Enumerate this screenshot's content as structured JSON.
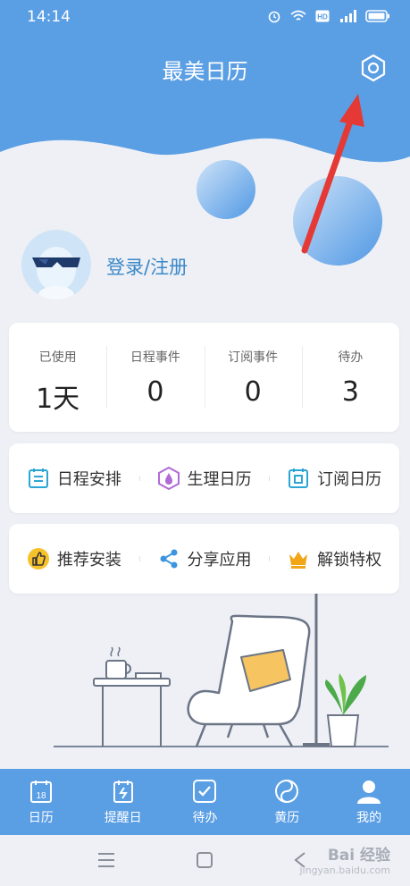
{
  "status_bar": {
    "time": "14:14"
  },
  "header": {
    "title": "最美日历"
  },
  "profile": {
    "login_label": "登录/注册"
  },
  "stats": [
    {
      "label": "已使用",
      "value": "1天"
    },
    {
      "label": "日程事件",
      "value": "0"
    },
    {
      "label": "订阅事件",
      "value": "0"
    },
    {
      "label": "待办",
      "value": "3"
    }
  ],
  "features_row1": [
    {
      "label": "日程安排",
      "icon": "schedule-icon"
    },
    {
      "label": "生理日历",
      "icon": "drop-icon"
    },
    {
      "label": "订阅日历",
      "icon": "subscribe-icon"
    }
  ],
  "features_row2": [
    {
      "label": "推荐安装",
      "icon": "thumbs-up-icon"
    },
    {
      "label": "分享应用",
      "icon": "share-icon"
    },
    {
      "label": "解锁特权",
      "icon": "crown-icon"
    }
  ],
  "tabs": [
    {
      "label": "日历",
      "icon": "calendar-icon",
      "day": "18"
    },
    {
      "label": "提醒日",
      "icon": "reminder-icon"
    },
    {
      "label": "待办",
      "icon": "todo-icon"
    },
    {
      "label": "黄历",
      "icon": "almanac-icon"
    },
    {
      "label": "我的",
      "icon": "profile-icon"
    }
  ],
  "watermark": {
    "brand": "Bai 经验",
    "url": "jingyan.baidu.com"
  },
  "colors": {
    "header_blue": "#5a9ee4",
    "accent_text": "#3a88c8",
    "annotation_red": "#e53935"
  }
}
